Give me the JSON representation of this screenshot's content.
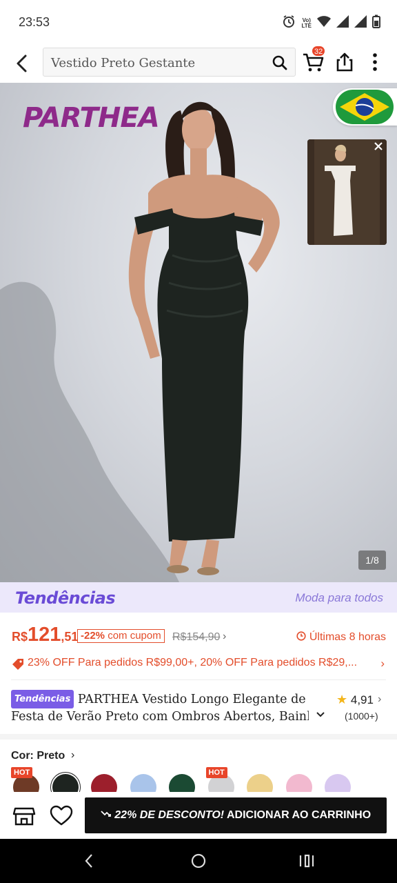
{
  "status_bar": {
    "time": "23:53",
    "network_label": "Vo)) LTE"
  },
  "header": {
    "search_value": "Vestido Preto Gestante",
    "cart_count": "32"
  },
  "gallery": {
    "brand": "PARTHEA",
    "counter": "1/8",
    "flag_country": "Brazil"
  },
  "trend_banner": {
    "logo": "Tendências",
    "tagline": "Moda para todos"
  },
  "pricing": {
    "currency": "R$",
    "price_int": "121",
    "price_dec": ",51",
    "discount_pct": "-22%",
    "discount_text": "com cupom",
    "old_price": "R$154,90",
    "countdown": "Últimas 8 horas",
    "promo": "23% OFF Para pedidos R$99,00+,  20% OFF Para pedidos R$29,..."
  },
  "product": {
    "chip": "Tendências",
    "title_line1": "PARTHEA Vestido Longo Elegante de",
    "title_line2": "Festa de Verão Preto com Ombros Abertos, Bainha",
    "rating": "4,91",
    "review_count": "(1000+)"
  },
  "color": {
    "label": "Cor: Preto",
    "selected_index": 1,
    "swatches": [
      {
        "color": "#6e3a26",
        "hot": true
      },
      {
        "color": "#1e2420",
        "hot": false
      },
      {
        "color": "#9c1f2c",
        "hot": false
      },
      {
        "color": "#a9c4ea",
        "hot": false
      },
      {
        "color": "#1b4a33",
        "hot": false
      },
      {
        "color": "#d2d2d4",
        "hot": true
      },
      {
        "color": "#ecd08a",
        "hot": false
      },
      {
        "color": "#f2b9cf",
        "hot": false
      },
      {
        "color": "#d8c8f0",
        "hot": false
      }
    ],
    "hot_label": "HOT"
  },
  "actions": {
    "add_cart_discount": "22% DE DESCONTO!",
    "add_cart_label": "ADICIONAR AO CARRINHO"
  },
  "colors": {
    "accent": "#e34d2b",
    "trend_purple": "#7a5de6",
    "brand_magenta": "#8e2a8a"
  }
}
